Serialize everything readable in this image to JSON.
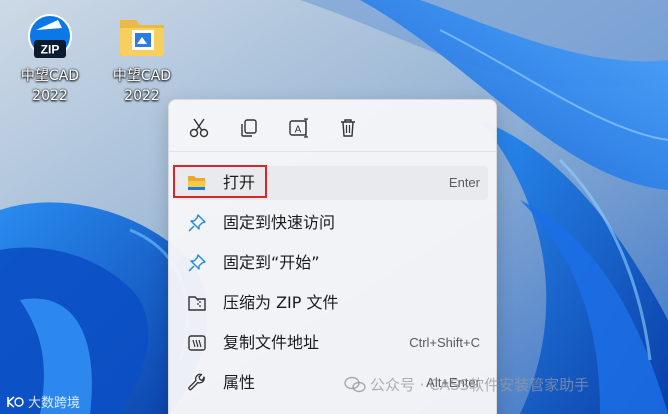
{
  "desktop": {
    "icons": [
      {
        "icon": "zip-app-icon",
        "badge": "ZIP",
        "label": "中望CAD\n2022"
      },
      {
        "icon": "folder-icon",
        "label": "中望CAD\n2022"
      }
    ]
  },
  "context_menu": {
    "toolbar": [
      {
        "icon": "cut-icon"
      },
      {
        "icon": "copy-icon"
      },
      {
        "icon": "rename-icon"
      },
      {
        "icon": "delete-icon"
      }
    ],
    "items": [
      {
        "icon": "folder-open-icon",
        "label": "打开",
        "shortcut": "Enter"
      },
      {
        "icon": "pin-icon",
        "label": "固定到快速访问",
        "shortcut": ""
      },
      {
        "icon": "pin-icon",
        "label": "固定到“开始”",
        "shortcut": ""
      },
      {
        "icon": "zip-icon",
        "label": "压缩为 ZIP 文件",
        "shortcut": ""
      },
      {
        "icon": "copy-path-icon",
        "label": "复制文件地址",
        "shortcut": "Ctrl+Shift+C"
      },
      {
        "icon": "wrench-icon",
        "label": "属性",
        "shortcut": "Alt+Enter"
      }
    ]
  },
  "watermarks": {
    "left": "大数跨境",
    "right": "公众号 · CASS软件安装管家助手"
  },
  "colors": {
    "highlight": "#d9262c",
    "accent": "#0a64c8"
  }
}
